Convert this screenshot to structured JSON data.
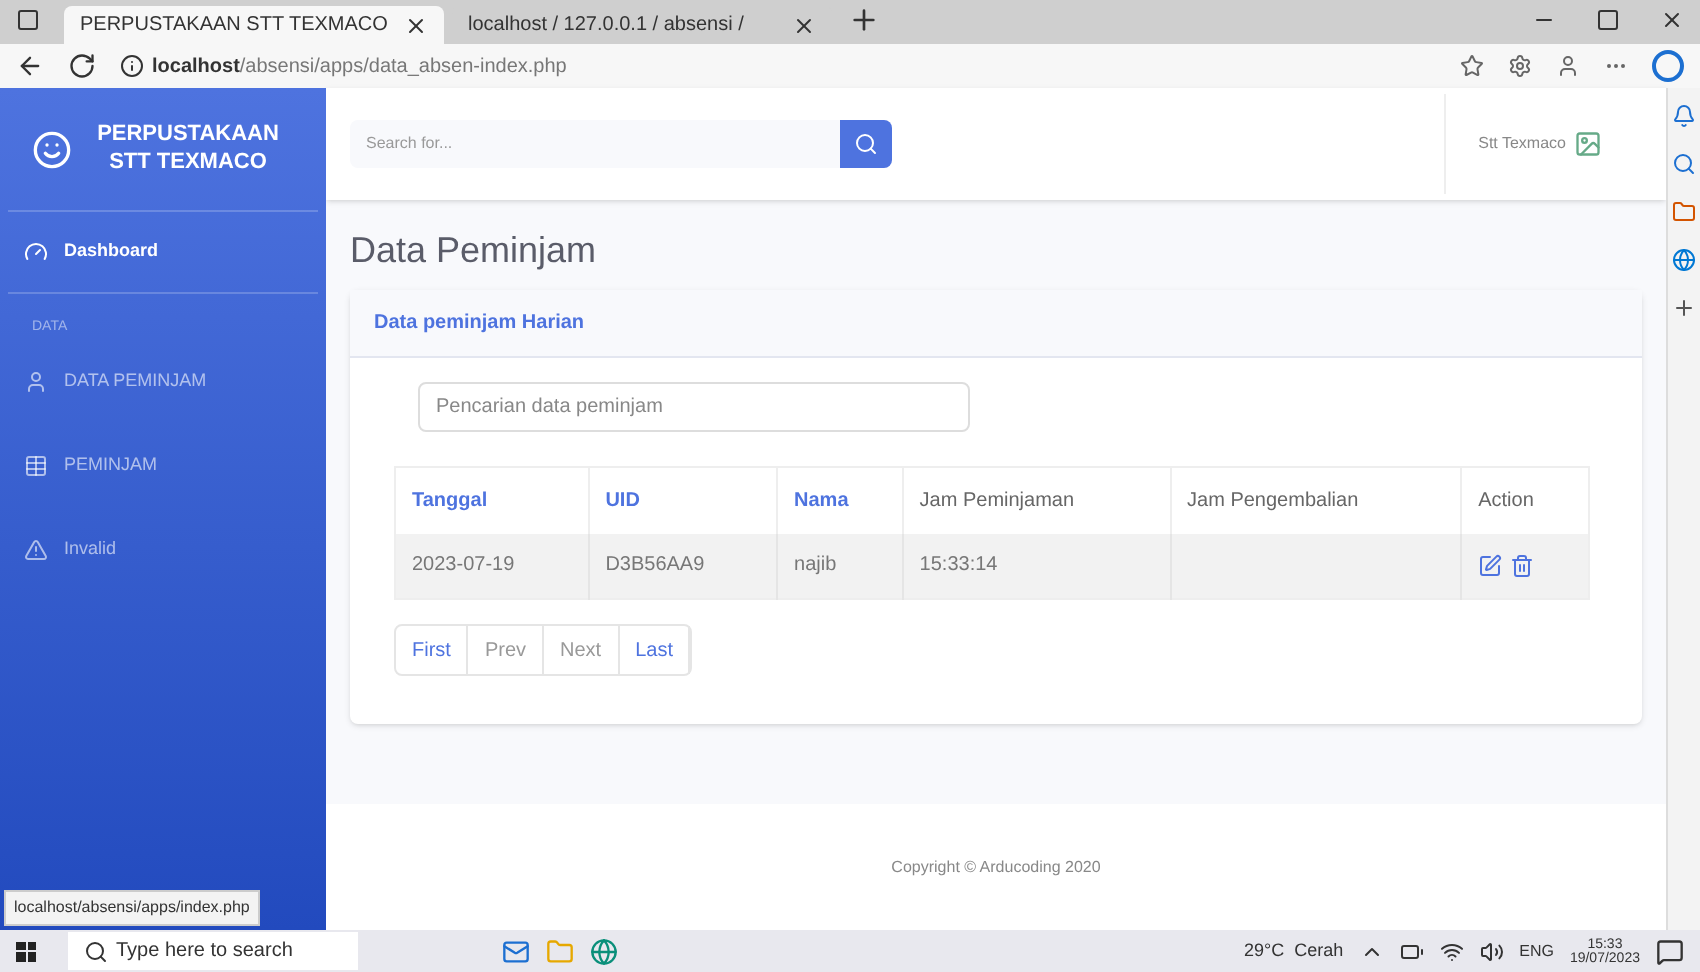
{
  "browser": {
    "tabs": [
      {
        "label": "PERPUSTAKAAN STT TEXMACO",
        "selected": true
      },
      {
        "label": "localhost / 127.0.0.1 / absensi / ",
        "selected": false
      }
    ],
    "url_host": "localhost",
    "url_path": "/absensi/apps/data_absen-index.php",
    "status_url": "localhost/absensi/apps/index.php"
  },
  "sidebar": {
    "brand": "PERPUSTAKAAN STT TEXMACO",
    "heading": "DATA",
    "items": [
      {
        "label": "Dashboard",
        "selected": true,
        "kind": "gauge"
      },
      {
        "label": "DATA PEMINJAM",
        "selected": false,
        "kind": "user"
      },
      {
        "label": "PEMINJAM",
        "selected": false,
        "kind": "table"
      },
      {
        "label": "Invalid",
        "selected": false,
        "kind": "warning"
      }
    ]
  },
  "topbar": {
    "search": {
      "placeholder": "Search for..."
    },
    "user": "Stt Texmaco"
  },
  "page_title": "Data Peminjam",
  "card": {
    "title": "Data peminjam Harian",
    "search": {
      "placeholder": "Pencarian data peminjam"
    },
    "table": {
      "columns": [
        {
          "label": "Tanggal",
          "sortable": true
        },
        {
          "label": "UID",
          "sortable": true
        },
        {
          "label": "Nama",
          "sortable": true
        },
        {
          "label": "Jam Peminjaman",
          "sortable": false
        },
        {
          "label": "Jam Pengembalian",
          "sortable": false
        },
        {
          "label": "Action",
          "sortable": false
        }
      ],
      "rows": [
        {
          "cells": [
            "2023-07-19",
            "D3B56AA9",
            "najib",
            "15:33:14",
            ""
          ]
        }
      ]
    },
    "pagination": [
      {
        "label": "First",
        "disabled": false
      },
      {
        "label": "Prev",
        "disabled": true
      },
      {
        "label": "Next",
        "disabled": true
      },
      {
        "label": "Last",
        "disabled": false
      }
    ]
  },
  "footer": "Copyright © Arducoding 2020",
  "taskbar": {
    "search_placeholder": "Type here to search",
    "weather": "29°C  Cerah",
    "language": "ENG",
    "time": "15:33",
    "date": "19/07/2023"
  }
}
